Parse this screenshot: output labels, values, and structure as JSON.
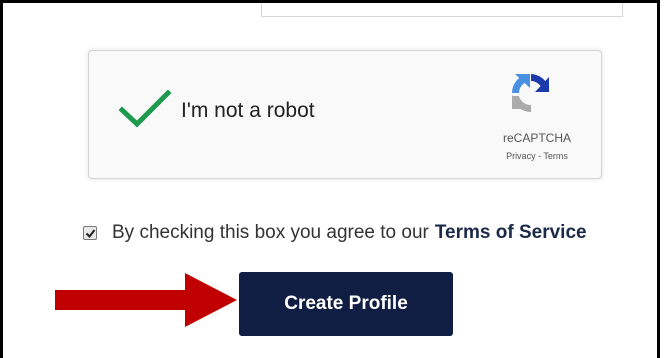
{
  "recaptcha": {
    "label": "I'm not a robot",
    "checked": true,
    "brand": "reCAPTCHA",
    "privacy_link": "Privacy",
    "separator": " - ",
    "terms_link": "Terms",
    "check_icon": "green-checkmark-icon",
    "logo_icon": "recaptcha-logo-icon"
  },
  "agreement": {
    "checked": true,
    "text": "By checking this box you agree to our",
    "link_text": "Terms of Service"
  },
  "actions": {
    "create_profile_label": "Create Profile"
  },
  "annotation": {
    "arrow_icon": "red-arrow-icon",
    "arrow_color": "#c00000"
  },
  "colors": {
    "button_bg": "#0f1e42",
    "check_green": "#1e9a4e",
    "link_color": "#1a2a48"
  }
}
